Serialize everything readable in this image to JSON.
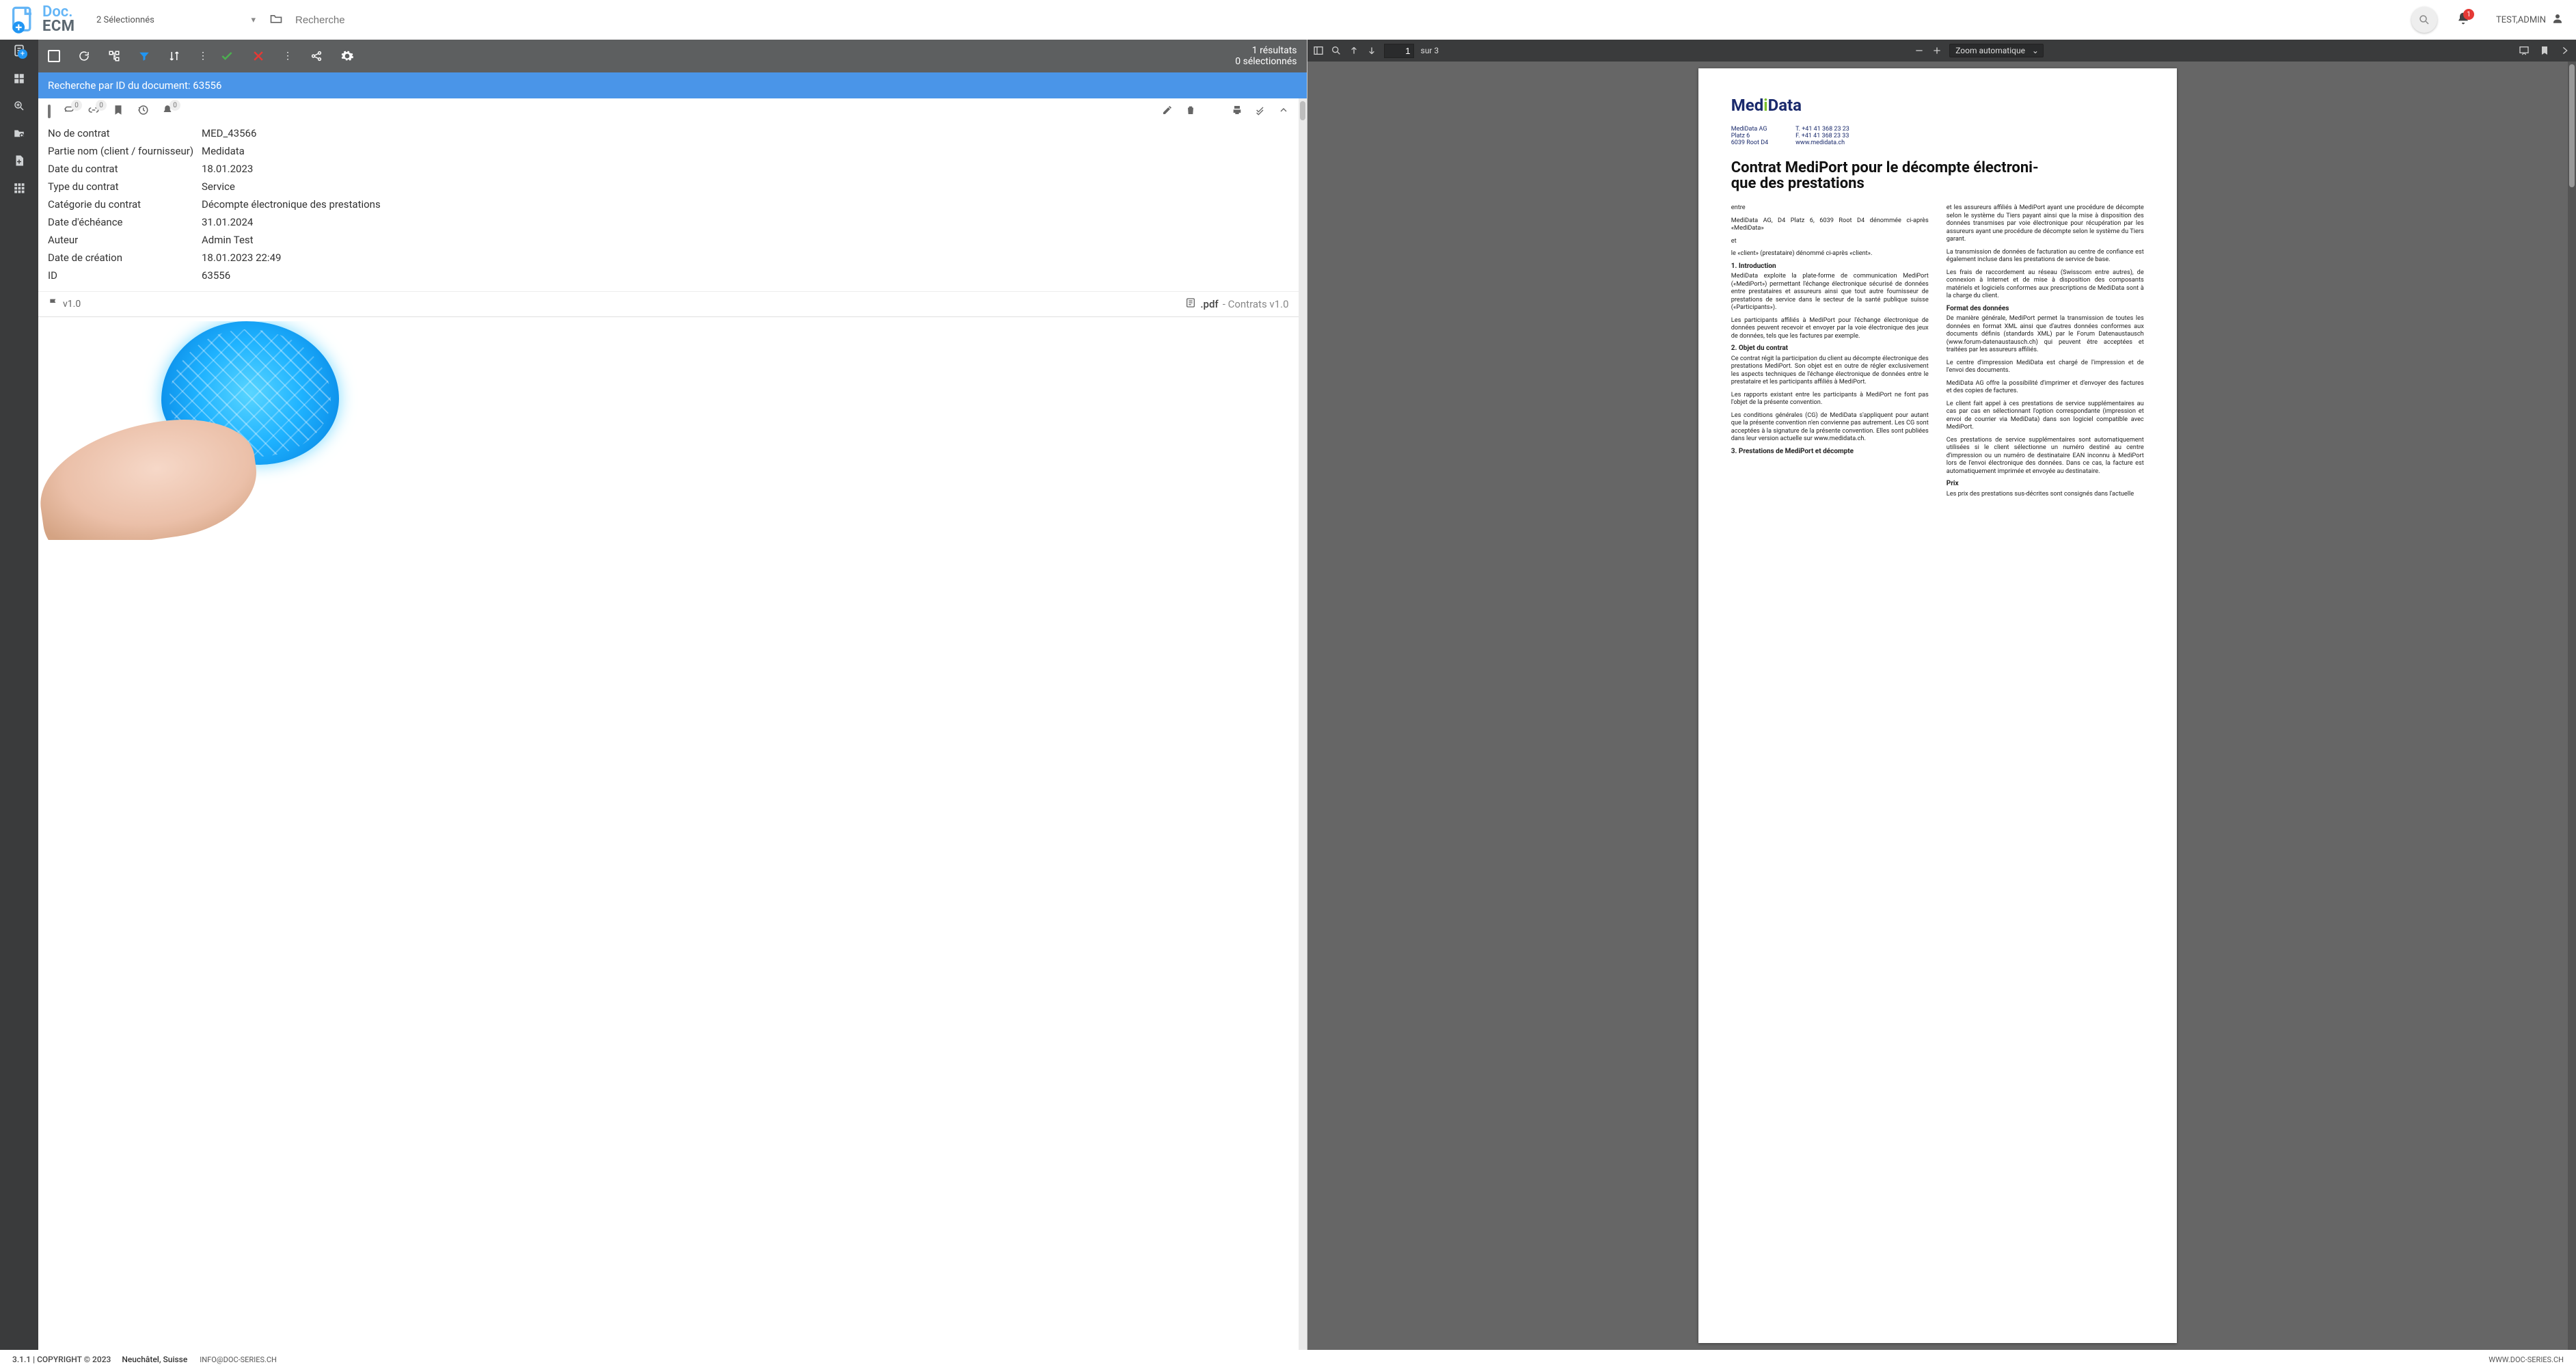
{
  "header": {
    "selection_text": "2 Sélectionnés",
    "search_placeholder": "Recherche",
    "notifications": "1",
    "user_name": "TEST,ADMIN"
  },
  "toolbar": {
    "results_line": "1 résultats",
    "selected_line": "0 sélectionnés"
  },
  "search_banner": "Recherche par ID du document: 63556",
  "card": {
    "badges": {
      "attach": "0",
      "link": "0",
      "bell": "0"
    },
    "rows": [
      {
        "k": "No de contrat",
        "v": "MED_43566"
      },
      {
        "k": "Partie nom (client / fournisseur)",
        "v": "Medidata"
      },
      {
        "k": "Date du contrat",
        "v": "18.01.2023"
      },
      {
        "k": "Type du contrat",
        "v": "Service"
      },
      {
        "k": "Catégorie du contrat",
        "v": "Décompte électronique des prestations"
      },
      {
        "k": "Date d'échéance",
        "v": "31.01.2024"
      },
      {
        "k": "Auteur",
        "v": "Admin Test"
      },
      {
        "k": "Date de création",
        "v": "18.01.2023 22:49"
      },
      {
        "k": "ID",
        "v": "63556"
      }
    ],
    "version": "v1.0",
    "ext": ".pdf",
    "template": "- Contrats v1.0"
  },
  "viewer": {
    "page_current": "1",
    "page_total_label": "sur 3",
    "zoom_label": "Zoom automatique"
  },
  "document": {
    "logo_parts": {
      "a": "Med",
      "b": "i",
      "c": "Data"
    },
    "addr_left": [
      "MediData AG",
      "Platz 6",
      "6039 Root D4"
    ],
    "addr_right": [
      "T. +41 41 368 23 23",
      "F. +41 41 368 23 33",
      "www.medidata.ch"
    ],
    "title_l1": "Contrat MediPort pour le décompte électroni-",
    "title_l2": "que des prestations",
    "left_col": [
      "entre",
      "MediData AG, D4 Platz 6, 6039 Root D4 dénommée ci-après «MediData»",
      "et",
      "le «client» (prestataire) dénommé ci-après «client».",
      "§1.   Introduction",
      "MediData exploite la plate-forme de communication MediPort («MediPort») permettant l'échange électronique sécurisé de données entre prestataires et assureurs ainsi que tout autre fournisseur de prestations de service dans le secteur de la santé publique suisse («Participants»).",
      "Les participants affiliés à MediPort pour l'échange électronique de données peuvent recevoir et envoyer par la voie électronique des jeux de données, tels que les factures par exemple.",
      "§2.   Objet du contrat",
      "Ce contrat régit la participation du client au décompte électronique des prestations MediPort. Son objet est en outre de régler exclusivement les aspects techniques de l'échange électronique de données entre le prestataire et les participants affiliés à MediPort.",
      "Les rapports existant entre les participants à MediPort ne font pas l'objet de la présente convention.",
      "Les conditions générales (CG) de MediData s'appliquent pour autant que la présente convention n'en convienne pas autrement. Les CG sont acceptées à la signature de la présente convention. Elles sont publiées dans leur version actuelle sur www.medidata.ch.",
      "§3.   Prestations de MediPort et décompte"
    ],
    "right_col": [
      "et les assureurs affiliés à MediPort ayant une procédure de décompte selon le système du Tiers payant ainsi que la mise à disposition des données transmises par voie électronique pour récupération par les assureurs ayant une procédure de décompte selon le système du Tiers garant.",
      "La transmission de données de facturation au centre de confiance est également incluse dans les prestations de service de base.",
      "Les frais de raccordement au réseau (Swisscom entre autres), de connexion à Internet et de mise à disposition des composants matériels et logiciels conformes aux prescriptions de MediData sont à la charge du client.",
      "§Format des données",
      "De manière générale, MediPort permet la transmission de toutes les données en format XML ainsi que d'autres données conformes aux documents définis (standards XML) par le Forum Datenaustausch (www.forum-datenaustausch.ch) qui peuvent être acceptées et traitées par les assureurs affiliés.",
      "Le centre d'impression MediData est chargé de l'impression et de l'envoi des documents.",
      "MediData AG offre la possibilité d'imprimer et d'envoyer des factures et des copies de factures.",
      "Le client fait appel à ces prestations de service supplémentaires au cas par cas en sélectionnant l'option correspondante (impression et envoi de courrier via MediData) dans son logiciel compatible avec MediPort.",
      "Ces prestations de service supplémentaires sont automatiquement utilisées si le client sélectionne un numéro destiné au centre d'impression ou un numéro de destinataire EAN inconnu à MediPort lors de l'envoi électronique des données. Dans ce cas, la facture est automatiquement imprimée et envoyée au destinataire.",
      "§Prix",
      "Les prix des prestations sus-décrites sont consignés dans l'actuelle"
    ]
  },
  "footer": {
    "version": "3.1.1 | COPYRIGHT © 2023",
    "location": "Neuchâtel, Suisse",
    "email": "INFO@DOC-SERIES.CH",
    "site": "WWW.DOC-SERIES.CH"
  }
}
